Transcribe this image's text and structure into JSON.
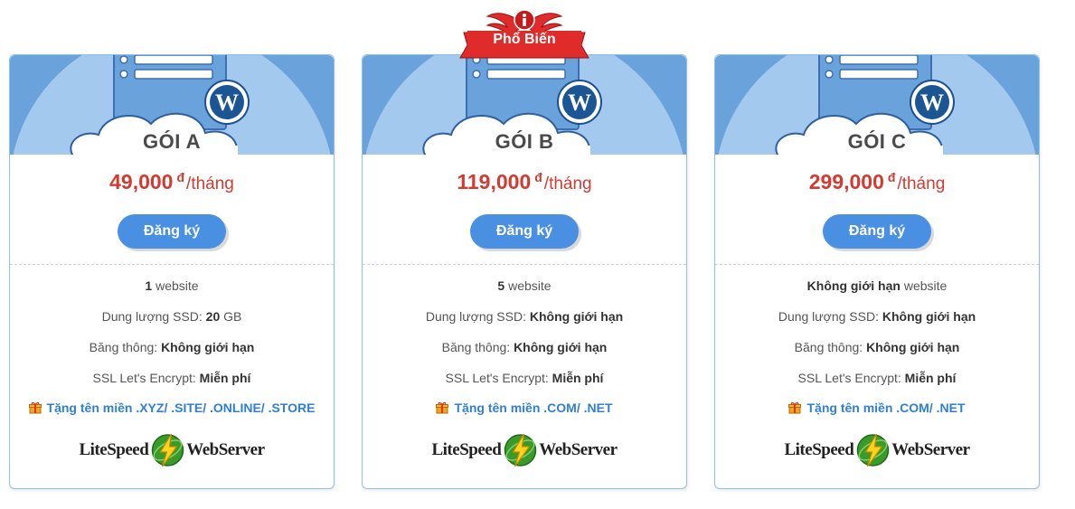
{
  "colors": {
    "accent": "#4a90e2",
    "price": "#d43a2f",
    "link": "#2f7fd6",
    "border": "#8fc0e8",
    "badge": "#e02b2b"
  },
  "badge": {
    "label": "Phổ Biến",
    "icon": "info-icon"
  },
  "plans": [
    {
      "name": "GÓI A",
      "price": "49,000",
      "currency": "đ",
      "period": "/tháng",
      "button": "Đăng ký",
      "websites_value": "1",
      "websites_label": " website",
      "ssd_label": "Dung lượng SSD: ",
      "ssd_value": "20",
      "ssd_unit": " GB",
      "bandwidth_label": "Băng thông: ",
      "bandwidth_value": "Không giới hạn",
      "ssl_label": "SSL Let's Encrypt: ",
      "ssl_value": "Miễn phí",
      "gift": "Tặng tên miền .XYZ/ .SITE/ .ONLINE/ .STORE",
      "logo_left": "LiteSpeed",
      "logo_right": "WebServer"
    },
    {
      "name": "GÓI B",
      "price": "119,000",
      "currency": "đ",
      "period": "/tháng",
      "button": "Đăng ký",
      "websites_value": "5",
      "websites_label": " website",
      "ssd_label": "Dung lượng SSD: ",
      "ssd_value": "Không giới hạn",
      "ssd_unit": "",
      "bandwidth_label": "Băng thông: ",
      "bandwidth_value": "Không giới hạn",
      "ssl_label": "SSL Let's Encrypt: ",
      "ssl_value": "Miễn phí",
      "gift": "Tặng tên miền .COM/ .NET",
      "logo_left": "LiteSpeed",
      "logo_right": "WebServer"
    },
    {
      "name": "GÓI C",
      "price": "299,000",
      "currency": "đ",
      "period": "/tháng",
      "button": "Đăng ký",
      "websites_value": "Không giới hạn",
      "websites_label": " website",
      "ssd_label": "Dung lượng SSD: ",
      "ssd_value": "Không giới hạn",
      "ssd_unit": "",
      "bandwidth_label": "Băng thông: ",
      "bandwidth_value": "Không giới hạn",
      "ssl_label": "SSL Let's Encrypt: ",
      "ssl_value": "Miễn phí",
      "gift": "Tặng tên miền .COM/ .NET",
      "logo_left": "LiteSpeed",
      "logo_right": "WebServer"
    }
  ]
}
